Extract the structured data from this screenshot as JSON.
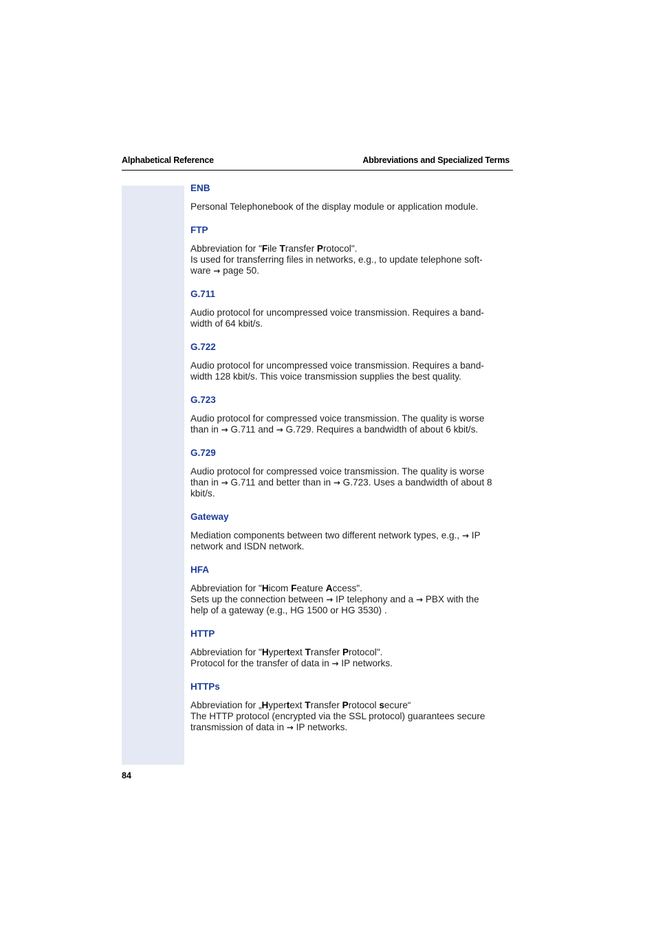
{
  "header": {
    "left": "Alphabetical Reference",
    "right": "Abbreviations and Specialized Terms"
  },
  "page_number": "84",
  "entries": [
    {
      "term": "ENB",
      "lines": [
        "Personal Telephonebook of the display module or application module."
      ]
    },
    {
      "term": "FTP",
      "abbrev_prefix": "Abbreviation for \"",
      "abbrev_parts": [
        [
          "F",
          "ile "
        ],
        [
          "T",
          "ransfer "
        ],
        [
          "P",
          "rotocol"
        ]
      ],
      "abbrev_suffix": "\".",
      "lines": [
        "Is used for transferring files in networks, e.g., to update telephone soft-",
        "ware → page 50."
      ]
    },
    {
      "term": "G.711",
      "lines": [
        "Audio protocol for uncompressed voice transmission. Requires a band-",
        "width of 64 kbit/s."
      ]
    },
    {
      "term": "G.722",
      "lines": [
        "Audio protocol for uncompressed voice transmission. Requires a band-",
        "width 128 kbit/s. This voice transmission supplies the best quality."
      ]
    },
    {
      "term": "G.723",
      "lines": [
        "Audio protocol for compressed voice transmission. The quality is worse",
        "than in → G.711 and → G.729. Requires a bandwidth of about 6 kbit/s."
      ]
    },
    {
      "term": "G.729",
      "lines": [
        "Audio protocol for compressed voice transmission. The quality is worse",
        "than in → G.711 and better than in → G.723. Uses a bandwidth of about 8",
        "kbit/s."
      ]
    },
    {
      "term": "Gateway",
      "lines": [
        "Mediation components between two different network types, e.g., → IP",
        "network and ISDN network."
      ]
    },
    {
      "term": "HFA",
      "abbrev_prefix": "Abbreviation for \"",
      "abbrev_parts": [
        [
          "H",
          "icom "
        ],
        [
          "F",
          "eature "
        ],
        [
          "A",
          "ccess"
        ]
      ],
      "abbrev_suffix": "\".",
      "lines": [
        "Sets up the connection between → IP telephony and a → PBX with the",
        "help of a gateway (e.g., HG 1500 or HG 3530) ."
      ]
    },
    {
      "term": "HTTP",
      "abbrev_prefix": "Abbreviation for \"",
      "abbrev_parts": [
        [
          "H",
          "yper"
        ],
        [
          "t",
          "ext "
        ],
        [
          "T",
          "ransfer "
        ],
        [
          "P",
          "rotocol"
        ]
      ],
      "abbrev_suffix": "\".",
      "lines": [
        "Protocol for the transfer of data in → IP networks."
      ]
    },
    {
      "term": "HTTPs",
      "abbrev_prefix": "Abbreviation for „",
      "abbrev_parts": [
        [
          "H",
          "yper"
        ],
        [
          "t",
          "ext "
        ],
        [
          "T",
          "ransfer "
        ],
        [
          "P",
          "rotocol "
        ],
        [
          "s",
          "ecure"
        ]
      ],
      "abbrev_suffix": "“",
      "lines": [
        "The HTTP protocol (encrypted via the SSL protocol) guarantees secure",
        "transmission of data in → IP networks."
      ]
    }
  ]
}
